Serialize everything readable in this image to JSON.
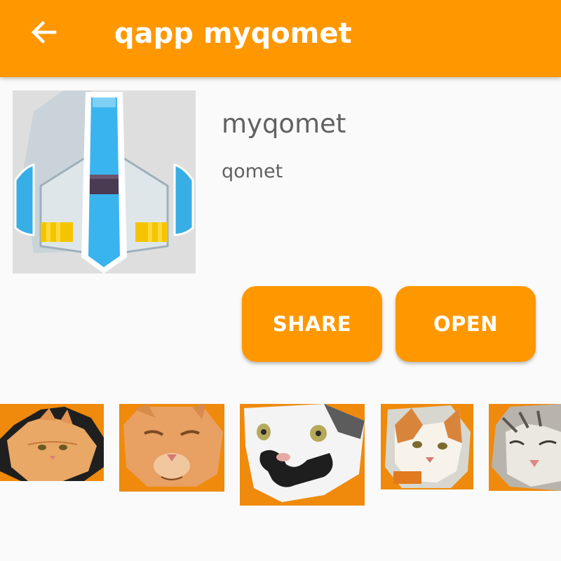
{
  "appbar": {
    "back_icon": "arrow-back-icon",
    "title": "qapp myqomet",
    "color": "#ff9800"
  },
  "app": {
    "icon": "spaceship-icon",
    "name": "myqomet",
    "subtitle": "qomet"
  },
  "actions": {
    "share_label": "SHARE",
    "open_label": "OPEN",
    "color": "#ff9800"
  },
  "thumbnails": [
    {
      "icon": "cat-face-thumbnail"
    },
    {
      "icon": "cat-face-thumbnail"
    },
    {
      "icon": "cat-face-thumbnail"
    },
    {
      "icon": "cat-face-thumbnail"
    },
    {
      "icon": "cat-face-thumbnail"
    }
  ]
}
